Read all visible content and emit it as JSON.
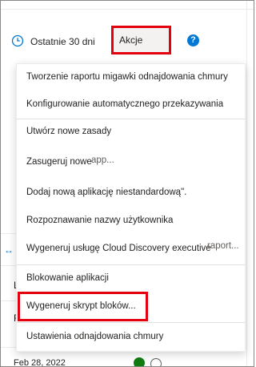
{
  "toolbar": {
    "date_range": "Ostatnie 30 dni",
    "actions_label": "Akcje",
    "help_icon": "?"
  },
  "background": {
    "row_letter_1": "L",
    "row_letter_2": "F",
    "row_date": "Feb 28, 2022"
  },
  "menu": {
    "items": [
      {
        "label": "Tworzenie raportu migawki odnajdowania chmury"
      },
      {
        "label": "Konfigurowanie automatycznego przekazywania"
      },
      {
        "label": "Utwórz nowe zasady"
      },
      {
        "label": "Zasugeruj nowe"
      },
      {
        "label": "Dodaj nową aplikację niestandardową\"."
      },
      {
        "label": "Rozpoznawanie nazwy użytkownika"
      },
      {
        "label": "Wygeneruj usługę Cloud Discovery executive"
      },
      {
        "label": "Blokowanie aplikacji"
      },
      {
        "label": "Wygeneruj skrypt bloków..."
      },
      {
        "label": "Ustawienia odnajdowania chmury"
      }
    ],
    "overlay_app": "app...",
    "overlay_report": "raport..."
  },
  "colors": {
    "highlight": "#e3000f",
    "accent": "#0078d4"
  }
}
